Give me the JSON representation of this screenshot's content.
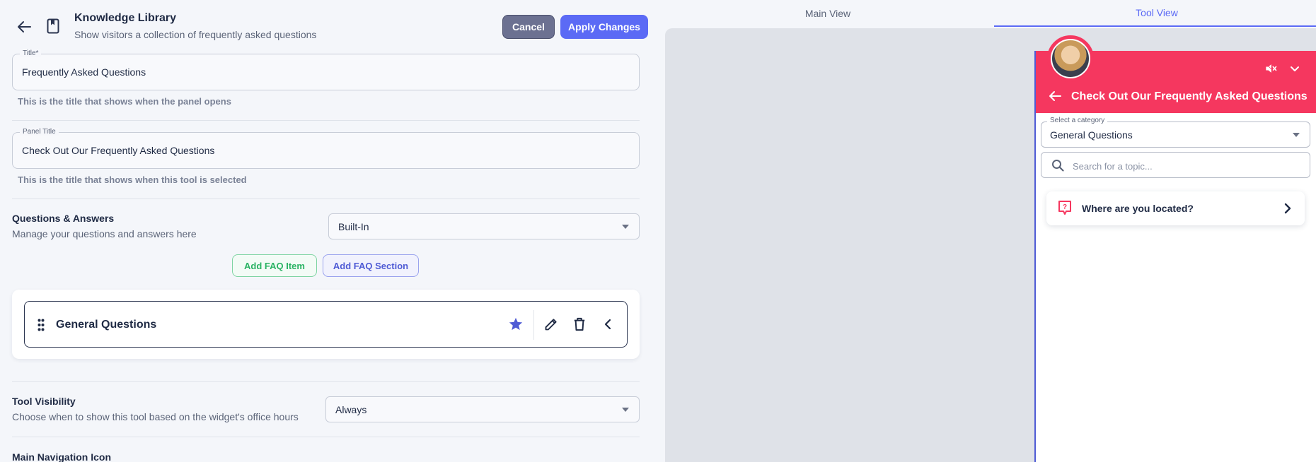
{
  "header": {
    "title": "Knowledge Library",
    "subtitle": "Show visitors a collection of frequently asked questions",
    "cancel_label": "Cancel",
    "apply_label": "Apply Changes"
  },
  "title_field": {
    "label": "Title*",
    "value": "Frequently Asked Questions",
    "hint": "This is the title that shows when the panel opens"
  },
  "panel_title_field": {
    "label": "Panel Title",
    "value": "Check Out Our Frequently Asked Questions",
    "hint": "This is the title that shows when this tool is selected"
  },
  "qa": {
    "title": "Questions & Answers",
    "subtitle": "Manage your questions and answers here",
    "source_value": "Built-In",
    "add_item_label": "Add FAQ Item",
    "add_section_label": "Add FAQ Section"
  },
  "sections": [
    {
      "name": "General Questions"
    }
  ],
  "visibility": {
    "title": "Tool Visibility",
    "subtitle": "Choose when to show this tool based on the widget's office hours",
    "value": "Always"
  },
  "main_nav": {
    "title": "Main Navigation Icon"
  },
  "tabs": [
    {
      "label": "Main View",
      "active": false
    },
    {
      "label": "Tool View",
      "active": true
    }
  ],
  "widget": {
    "title": "Check Out Our Frequently Asked Questions",
    "category_label": "Select a category",
    "category_value": "General Questions",
    "search_placeholder": "Search for a topic...",
    "items": [
      {
        "question": "Where are you located?"
      }
    ],
    "accent_color": "#f5375f"
  },
  "colors": {
    "primary": "#5b6af5",
    "cancel": "#6c7191",
    "success": "#2bb364"
  }
}
